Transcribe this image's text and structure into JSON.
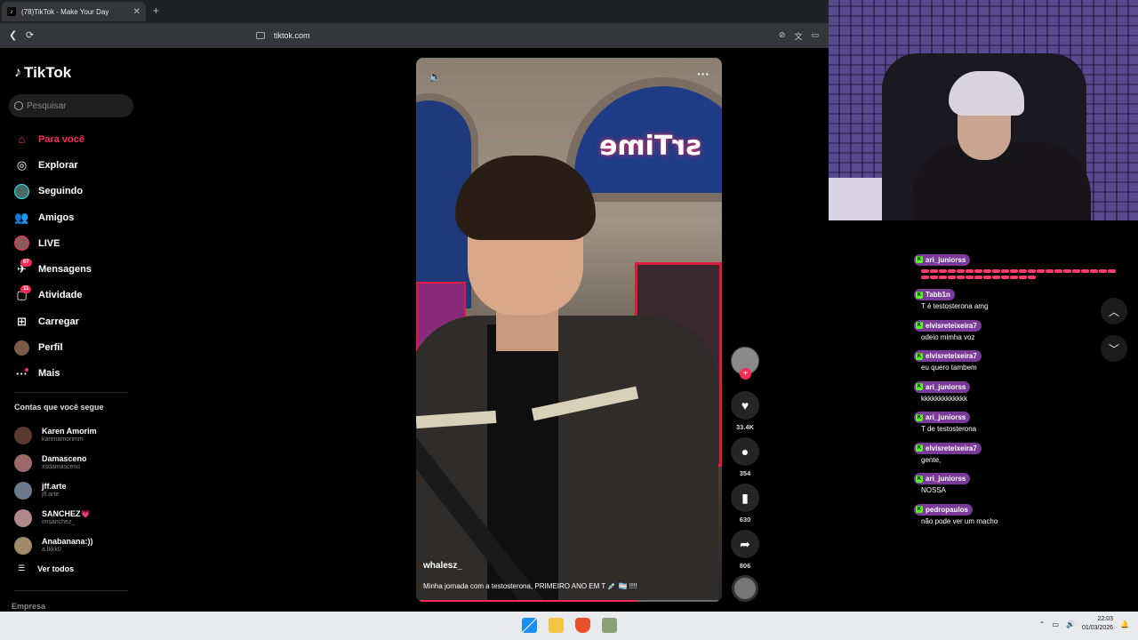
{
  "browser": {
    "tab_title": "(78)TikTok - Make Your Day",
    "tab_close": "✕",
    "new_tab": "+",
    "url": "tiktok.com"
  },
  "sidebar": {
    "logo": "TikTok",
    "search_placeholder": "Pesquisar",
    "menu": [
      {
        "label": "Para você",
        "icon": "home-icon"
      },
      {
        "label": "Explorar",
        "icon": "compass-icon"
      },
      {
        "label": "Seguindo",
        "icon": "following-avatar-icon"
      },
      {
        "label": "Amigos",
        "icon": "friends-icon"
      },
      {
        "label": "LIVE",
        "icon": "live-avatar-icon"
      },
      {
        "label": "Mensagens",
        "icon": "messages-icon",
        "badge": "67"
      },
      {
        "label": "Atividade",
        "icon": "activity-icon",
        "badge": "11"
      },
      {
        "label": "Carregar",
        "icon": "upload-icon"
      },
      {
        "label": "Perfil",
        "icon": "profile-avatar-icon"
      },
      {
        "label": "Mais",
        "icon": "more-icon"
      }
    ],
    "following_title": "Contas que você segue",
    "accounts": [
      {
        "name": "Karen Amorim",
        "user": "karenamorimm"
      },
      {
        "name": "Damasceno",
        "user": "xsdamasceno"
      },
      {
        "name": "jff.arte",
        "user": "jff.arte"
      },
      {
        "name": "SANCHEZ💗",
        "user": "imsanchez_"
      },
      {
        "name": "Anabanana:))",
        "user": "a.lkkk0"
      }
    ],
    "see_all": "Ver todos",
    "company": "Empresa"
  },
  "video": {
    "author": "whalesz_",
    "caption": "Minha jornada com a testosterona, PRIMEIRO ANO EM T 💉 🏳️‍⚧️ !!!!",
    "sign_text": "srTime",
    "progress": 0.73
  },
  "actions": {
    "likes": "33.4K",
    "comments": "354",
    "saves": "630",
    "shares": "806"
  },
  "chat": [
    {
      "user": "ari_juniorss",
      "text": "",
      "emotes": true
    },
    {
      "user": "Tabb1n",
      "text": "T é testosterona amg"
    },
    {
      "user": "elvisreteixeira7",
      "text": "odeio mimha voz"
    },
    {
      "user": "elvisreteixeira7",
      "text": "eu quero tambem"
    },
    {
      "user": "ari_juniorss",
      "text": "kkkkkkkkkkkkk"
    },
    {
      "user": "ari_juniorss",
      "text": "T de testosterona"
    },
    {
      "user": "elvisreteixeira7",
      "text": "gente,"
    },
    {
      "user": "ari_juniorss",
      "text": "NOSSA"
    },
    {
      "user": "pedropaulos",
      "text": "não pode ver um macho"
    }
  ],
  "taskbar": {
    "time": "22:03",
    "date": "01/03/2026"
  },
  "colors": {
    "accent": "#fe2c55",
    "kick_green": "#53fc18",
    "chat_badge": "#7a3a9a"
  }
}
